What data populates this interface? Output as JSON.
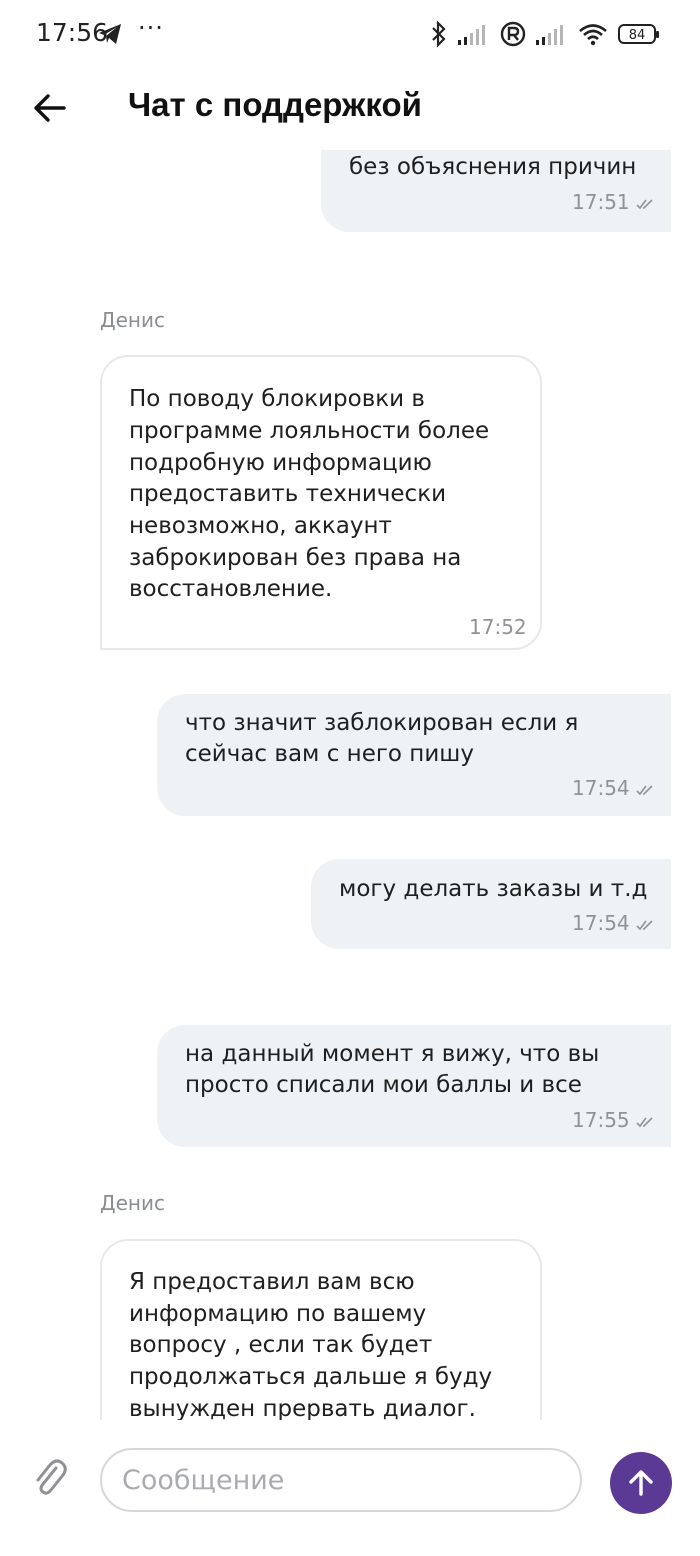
{
  "status_bar": {
    "time": "17:56",
    "dots": "···",
    "battery": "84",
    "icons": [
      "telegram-icon",
      "bluetooth-icon",
      "signal-icon",
      "roaming-icon",
      "signal-icon",
      "wifi-icon",
      "battery-icon"
    ]
  },
  "header": {
    "title": "Чат с поддержкой",
    "back_icon": "arrow-left-icon"
  },
  "messages": [
    {
      "direction": "out",
      "lines": [
        "без объяснения причин"
      ],
      "time": "17:51",
      "read": true
    },
    {
      "direction": "in",
      "sender": "Денис",
      "lines": [
        "По поводу блокировки в",
        "программе лояльности более",
        "подробную информацию",
        "предоставить технически",
        "невозможно, аккаунт",
        "заброкирован без права на",
        "восстановление."
      ],
      "time": "17:52"
    },
    {
      "direction": "out",
      "lines": [
        "что значит заблокирован если я",
        "сейчас вам с него пишу"
      ],
      "time": "17:54",
      "read": true
    },
    {
      "direction": "out",
      "lines": [
        "могу делать заказы и т.д"
      ],
      "time": "17:54",
      "read": true
    },
    {
      "direction": "out",
      "lines": [
        "на данный момент я вижу, что вы",
        "просто списали мои баллы и все"
      ],
      "time": "17:55",
      "read": true
    },
    {
      "direction": "in",
      "sender": "Денис",
      "lines": [
        "Я предоставил вам всю",
        "информацию по вашему",
        "вопросу , если так будет",
        "продолжаться дальше я буду",
        "вынужден прервать диалог."
      ]
    }
  ],
  "composer": {
    "placeholder": "Сообщение",
    "value": "",
    "attach_icon": "paperclip-icon",
    "send_icon": "arrow-up-icon"
  },
  "colors": {
    "accent": "#5b3a96",
    "outgoing_bubble": "#eff2f5",
    "incoming_border": "#e6e8eb",
    "time_text": "#8f9297"
  }
}
